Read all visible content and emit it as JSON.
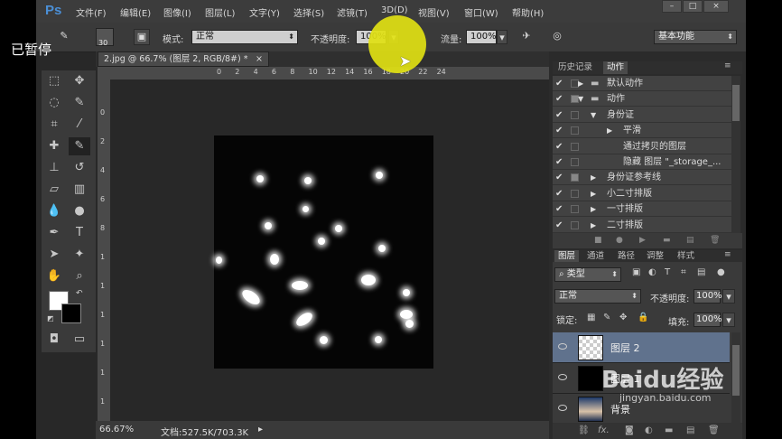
{
  "app": {
    "logo": "Ps",
    "paused_label": "已暂停"
  },
  "menu": [
    "文件(F)",
    "编辑(E)",
    "图像(I)",
    "图层(L)",
    "文字(Y)",
    "选择(S)",
    "滤镜(T)",
    "3D(D)",
    "视图(V)",
    "窗口(W)",
    "帮助(H)"
  ],
  "options": {
    "brush_size": "30",
    "mode_label": "模式:",
    "mode_value": "正常",
    "opacity_label": "不透明度:",
    "opacity_value": "100%",
    "flow_label": "流量:",
    "flow_value": "100%",
    "workspace": "基本功能"
  },
  "document": {
    "tab_title": "2.jpg @ 66.7% (图层 2, RGB/8#) *",
    "tab_close": "×",
    "zoom": "66.67%",
    "doc_info": "文档:527.5K/703.3K"
  },
  "rulers": {
    "h": [
      "0",
      "2",
      "4",
      "6",
      "8",
      "10",
      "12",
      "14",
      "16",
      "18",
      "20",
      "22",
      "24"
    ],
    "v": [
      "0",
      "2",
      "4",
      "6",
      "8",
      "1",
      "1",
      "1",
      "1",
      "1",
      "1",
      "2"
    ]
  },
  "actions_panel": {
    "tabs": [
      "历史记录",
      "动作"
    ],
    "rows": [
      {
        "label": "默认动作",
        "type": "set"
      },
      {
        "label": "动作",
        "type": "set"
      },
      {
        "label": "身份证",
        "type": "action"
      },
      {
        "label": "平滑",
        "type": "step"
      },
      {
        "label": "通过拷贝的图层",
        "type": "step"
      },
      {
        "label": "隐藏 图层 \"_storage_...",
        "type": "step"
      },
      {
        "label": "身份证参考线",
        "type": "action"
      },
      {
        "label": "小二寸排版",
        "type": "action"
      },
      {
        "label": "一寸排版",
        "type": "action"
      },
      {
        "label": "二寸排版",
        "type": "action"
      }
    ]
  },
  "layers_panel": {
    "tabs": [
      "图层",
      "通道",
      "路径",
      "调整",
      "样式"
    ],
    "filter_kind": "类型",
    "blend_mode": "正常",
    "opacity_label": "不透明度:",
    "opacity_value": "100%",
    "lock_label": "锁定:",
    "fill_label": "填充:",
    "fill_value": "100%",
    "layers": [
      {
        "name": "图层 2",
        "selected": true
      },
      {
        "name": "图层 1",
        "selected": false
      },
      {
        "name": "背景",
        "selected": false
      }
    ]
  },
  "watermark": {
    "brand": "Baidu经验",
    "url": "jingyan.baidu.com"
  }
}
